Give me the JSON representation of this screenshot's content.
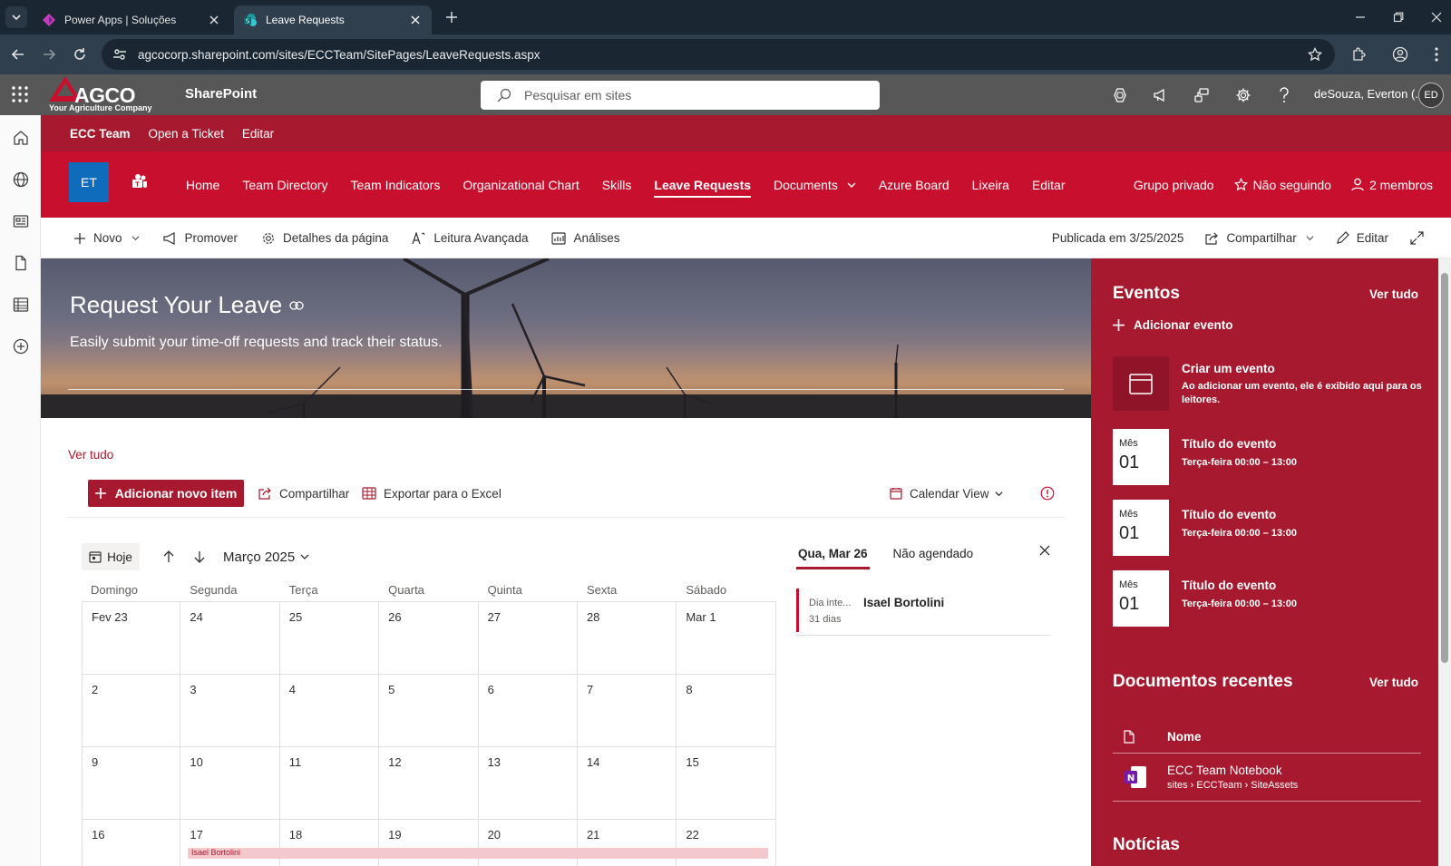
{
  "browser": {
    "tabs": [
      {
        "title": "Power Apps | Soluções",
        "active": false
      },
      {
        "title": "Leave Requests",
        "active": true
      }
    ],
    "url": "agcocorp.sharepoint.com/sites/ECCTeam/SitePages/LeaveRequests.aspx"
  },
  "suitebar": {
    "brand": "AGCO",
    "tagline": "Your Agriculture Company",
    "app_name": "SharePoint",
    "search_placeholder": "Pesquisar em sites",
    "user_name": "deSouza, Everton (...",
    "user_initials": "ED"
  },
  "hubnav": {
    "title": "ECC Team",
    "items": [
      "Open a Ticket",
      "Editar"
    ]
  },
  "site": {
    "logo_initials": "ET",
    "nav": [
      {
        "label": "Home"
      },
      {
        "label": "Team Directory"
      },
      {
        "label": "Team Indicators"
      },
      {
        "label": "Organizational Chart"
      },
      {
        "label": "Skills"
      },
      {
        "label": "Leave Requests",
        "active": true
      },
      {
        "label": "Documents",
        "dropdown": true
      },
      {
        "label": "Azure Board"
      },
      {
        "label": "Lixeira"
      },
      {
        "label": "Editar"
      }
    ],
    "privacy": "Grupo privado",
    "follow": "Não seguindo",
    "members": "2 membros"
  },
  "cmdbar": {
    "new": "Novo",
    "promote": "Promover",
    "page_details": "Detalhes da página",
    "immersive_reader": "Leitura Avançada",
    "analytics": "Análises",
    "published": "Publicada em 3/25/2025",
    "share": "Compartilhar",
    "edit": "Editar"
  },
  "hero": {
    "title": "Request Your Leave",
    "subtitle": "Easily submit your time-off requests and track their status."
  },
  "list": {
    "see_all": "Ver tudo",
    "add_item": "Adicionar novo item",
    "share": "Compartilhar",
    "export": "Exportar para o Excel",
    "view": "Calendar View"
  },
  "calendar": {
    "today": "Hoje",
    "month": "Março 2025",
    "weekdays": [
      "Domingo",
      "Segunda",
      "Terça",
      "Quarta",
      "Quinta",
      "Sexta",
      "Sábado"
    ],
    "weeks": [
      [
        "Fev 23",
        "24",
        "25",
        "26",
        "27",
        "28",
        "Mar 1"
      ],
      [
        "2",
        "3",
        "4",
        "5",
        "6",
        "7",
        "8"
      ],
      [
        "9",
        "10",
        "11",
        "12",
        "13",
        "14",
        "15"
      ],
      [
        "16",
        "17",
        "18",
        "19",
        "20",
        "21",
        "22"
      ]
    ],
    "event_bar_label": "Isael Bortolini"
  },
  "side_panel": {
    "tabs": [
      "Qua, Mar 26",
      "Não agendado"
    ],
    "item": {
      "kind": "Dia inte...",
      "person": "Isael Bortolini",
      "duration": "31 dias"
    }
  },
  "events": {
    "heading": "Eventos",
    "see_all": "Ver tudo",
    "add": "Adicionar evento",
    "empty_title": "Criar um evento",
    "empty_desc": "Ao adicionar um evento, ele é exibido aqui para os leitores.",
    "cards": [
      {
        "month": "Mês",
        "day": "01",
        "title": "Título do evento",
        "time": "Terça-feira 00:00 – 13:00"
      },
      {
        "month": "Mês",
        "day": "01",
        "title": "Título do evento",
        "time": "Terça-feira 00:00 – 13:00"
      },
      {
        "month": "Mês",
        "day": "01",
        "title": "Título do evento",
        "time": "Terça-feira 00:00 – 13:00"
      }
    ]
  },
  "recent_docs": {
    "heading": "Documentos recentes",
    "see_all": "Ver tudo",
    "col_name": "Nome",
    "items": [
      {
        "name": "ECC Team Notebook",
        "path": "sites › ECCTeam › SiteAssets"
      }
    ]
  },
  "news": {
    "heading": "Notícias"
  }
}
